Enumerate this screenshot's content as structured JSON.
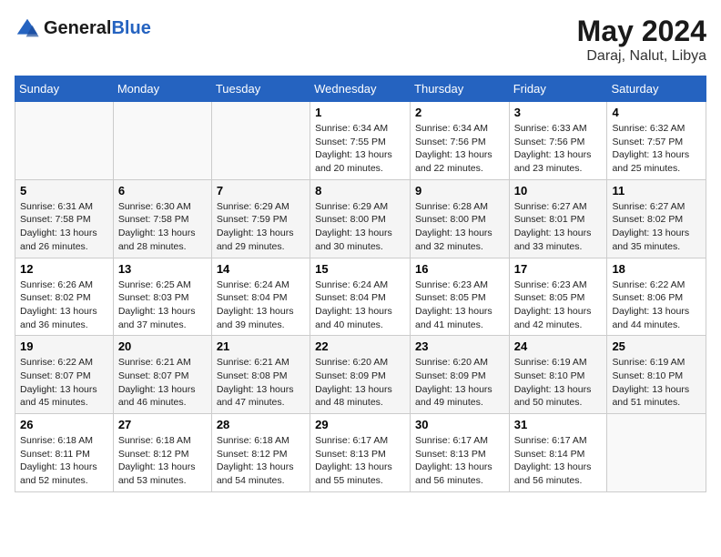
{
  "header": {
    "logo_line1": "General",
    "logo_line2": "Blue",
    "title": "May 2024",
    "subtitle": "Daraj, Nalut, Libya"
  },
  "days_of_week": [
    "Sunday",
    "Monday",
    "Tuesday",
    "Wednesday",
    "Thursday",
    "Friday",
    "Saturday"
  ],
  "weeks": [
    [
      {
        "day": "",
        "content": ""
      },
      {
        "day": "",
        "content": ""
      },
      {
        "day": "",
        "content": ""
      },
      {
        "day": "1",
        "content": "Sunrise: 6:34 AM\nSunset: 7:55 PM\nDaylight: 13 hours\nand 20 minutes."
      },
      {
        "day": "2",
        "content": "Sunrise: 6:34 AM\nSunset: 7:56 PM\nDaylight: 13 hours\nand 22 minutes."
      },
      {
        "day": "3",
        "content": "Sunrise: 6:33 AM\nSunset: 7:56 PM\nDaylight: 13 hours\nand 23 minutes."
      },
      {
        "day": "4",
        "content": "Sunrise: 6:32 AM\nSunset: 7:57 PM\nDaylight: 13 hours\nand 25 minutes."
      }
    ],
    [
      {
        "day": "5",
        "content": "Sunrise: 6:31 AM\nSunset: 7:58 PM\nDaylight: 13 hours\nand 26 minutes."
      },
      {
        "day": "6",
        "content": "Sunrise: 6:30 AM\nSunset: 7:58 PM\nDaylight: 13 hours\nand 28 minutes."
      },
      {
        "day": "7",
        "content": "Sunrise: 6:29 AM\nSunset: 7:59 PM\nDaylight: 13 hours\nand 29 minutes."
      },
      {
        "day": "8",
        "content": "Sunrise: 6:29 AM\nSunset: 8:00 PM\nDaylight: 13 hours\nand 30 minutes."
      },
      {
        "day": "9",
        "content": "Sunrise: 6:28 AM\nSunset: 8:00 PM\nDaylight: 13 hours\nand 32 minutes."
      },
      {
        "day": "10",
        "content": "Sunrise: 6:27 AM\nSunset: 8:01 PM\nDaylight: 13 hours\nand 33 minutes."
      },
      {
        "day": "11",
        "content": "Sunrise: 6:27 AM\nSunset: 8:02 PM\nDaylight: 13 hours\nand 35 minutes."
      }
    ],
    [
      {
        "day": "12",
        "content": "Sunrise: 6:26 AM\nSunset: 8:02 PM\nDaylight: 13 hours\nand 36 minutes."
      },
      {
        "day": "13",
        "content": "Sunrise: 6:25 AM\nSunset: 8:03 PM\nDaylight: 13 hours\nand 37 minutes."
      },
      {
        "day": "14",
        "content": "Sunrise: 6:24 AM\nSunset: 8:04 PM\nDaylight: 13 hours\nand 39 minutes."
      },
      {
        "day": "15",
        "content": "Sunrise: 6:24 AM\nSunset: 8:04 PM\nDaylight: 13 hours\nand 40 minutes."
      },
      {
        "day": "16",
        "content": "Sunrise: 6:23 AM\nSunset: 8:05 PM\nDaylight: 13 hours\nand 41 minutes."
      },
      {
        "day": "17",
        "content": "Sunrise: 6:23 AM\nSunset: 8:05 PM\nDaylight: 13 hours\nand 42 minutes."
      },
      {
        "day": "18",
        "content": "Sunrise: 6:22 AM\nSunset: 8:06 PM\nDaylight: 13 hours\nand 44 minutes."
      }
    ],
    [
      {
        "day": "19",
        "content": "Sunrise: 6:22 AM\nSunset: 8:07 PM\nDaylight: 13 hours\nand 45 minutes."
      },
      {
        "day": "20",
        "content": "Sunrise: 6:21 AM\nSunset: 8:07 PM\nDaylight: 13 hours\nand 46 minutes."
      },
      {
        "day": "21",
        "content": "Sunrise: 6:21 AM\nSunset: 8:08 PM\nDaylight: 13 hours\nand 47 minutes."
      },
      {
        "day": "22",
        "content": "Sunrise: 6:20 AM\nSunset: 8:09 PM\nDaylight: 13 hours\nand 48 minutes."
      },
      {
        "day": "23",
        "content": "Sunrise: 6:20 AM\nSunset: 8:09 PM\nDaylight: 13 hours\nand 49 minutes."
      },
      {
        "day": "24",
        "content": "Sunrise: 6:19 AM\nSunset: 8:10 PM\nDaylight: 13 hours\nand 50 minutes."
      },
      {
        "day": "25",
        "content": "Sunrise: 6:19 AM\nSunset: 8:10 PM\nDaylight: 13 hours\nand 51 minutes."
      }
    ],
    [
      {
        "day": "26",
        "content": "Sunrise: 6:18 AM\nSunset: 8:11 PM\nDaylight: 13 hours\nand 52 minutes."
      },
      {
        "day": "27",
        "content": "Sunrise: 6:18 AM\nSunset: 8:12 PM\nDaylight: 13 hours\nand 53 minutes."
      },
      {
        "day": "28",
        "content": "Sunrise: 6:18 AM\nSunset: 8:12 PM\nDaylight: 13 hours\nand 54 minutes."
      },
      {
        "day": "29",
        "content": "Sunrise: 6:17 AM\nSunset: 8:13 PM\nDaylight: 13 hours\nand 55 minutes."
      },
      {
        "day": "30",
        "content": "Sunrise: 6:17 AM\nSunset: 8:13 PM\nDaylight: 13 hours\nand 56 minutes."
      },
      {
        "day": "31",
        "content": "Sunrise: 6:17 AM\nSunset: 8:14 PM\nDaylight: 13 hours\nand 56 minutes."
      },
      {
        "day": "",
        "content": ""
      }
    ]
  ]
}
